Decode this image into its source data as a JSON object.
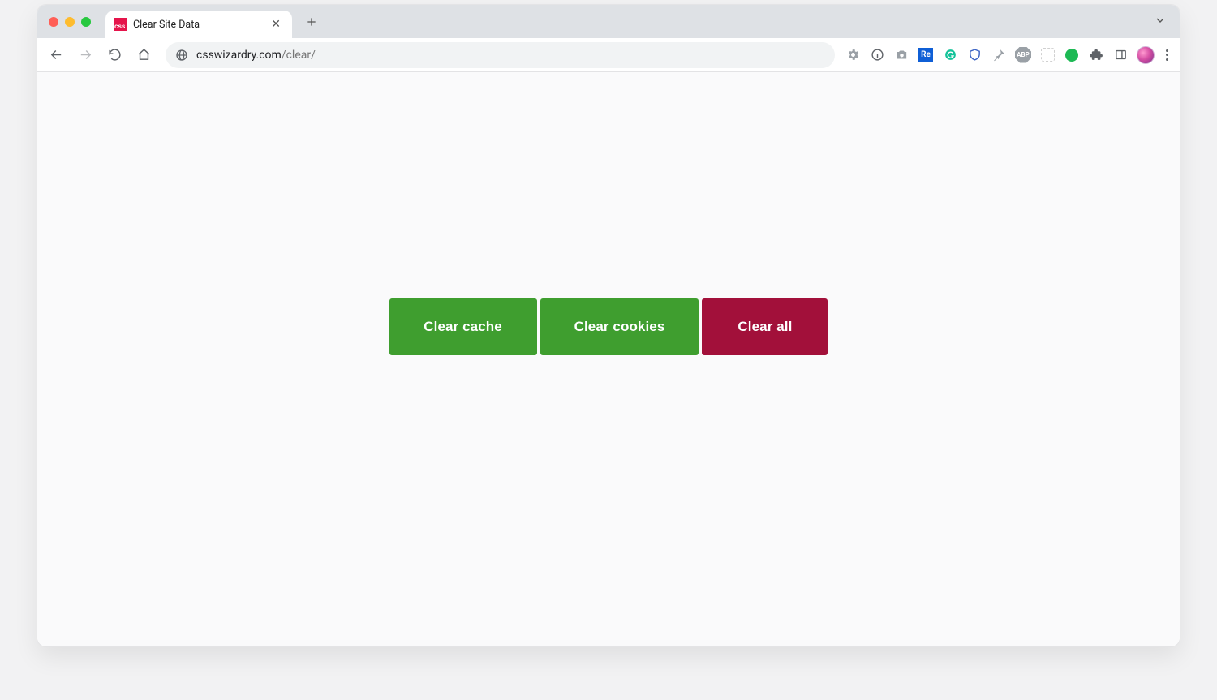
{
  "tabstrip": {
    "tab_title": "Clear Site Data",
    "favicon_text": "css"
  },
  "toolbar": {
    "url_host": "csswizardry.com",
    "url_path": "/clear/"
  },
  "extensions": {
    "re_label": "Re",
    "abp_label": "ABP"
  },
  "page": {
    "buttons": {
      "clear_cache": "Clear cache",
      "clear_cookies": "Clear cookies",
      "clear_all": "Clear all"
    }
  },
  "colors": {
    "green": "#3f9e2f",
    "red": "#a2103a"
  }
}
